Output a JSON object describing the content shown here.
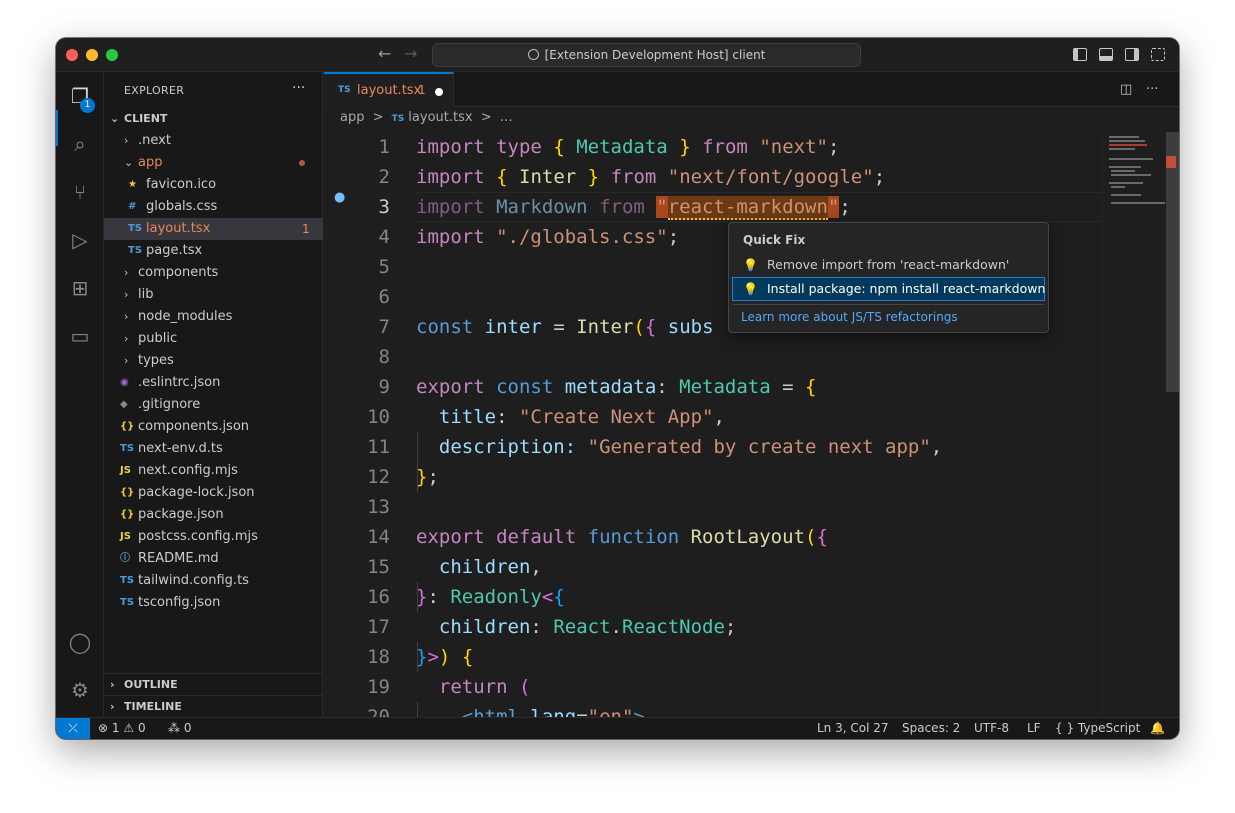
{
  "window": {
    "title": "[Extension Development Host] client"
  },
  "explorer": {
    "title": "EXPLORER",
    "badge": "1",
    "root": "CLIENT",
    "items": [
      {
        "label": ".next",
        "chev": "›",
        "icon": "",
        "color": "#cccccc"
      },
      {
        "label": "app",
        "chev": "⌄",
        "icon": "",
        "color": "#e7895d"
      },
      {
        "label": "favicon.ico",
        "chev": "",
        "icon": "★",
        "color": "#cccccc"
      },
      {
        "label": "globals.css",
        "chev": "",
        "icon": "#",
        "color": "#cccccc"
      },
      {
        "label": "layout.tsx",
        "chev": "",
        "icon": "TS",
        "color": "#e7895d",
        "count": "1"
      },
      {
        "label": "page.tsx",
        "chev": "",
        "icon": "TS",
        "color": "#cccccc"
      },
      {
        "label": "components",
        "chev": "›",
        "icon": "",
        "color": "#cccccc"
      },
      {
        "label": "lib",
        "chev": "›",
        "icon": "",
        "color": "#cccccc"
      },
      {
        "label": "node_modules",
        "chev": "›",
        "icon": "",
        "color": "#cccccc"
      },
      {
        "label": "public",
        "chev": "›",
        "icon": "",
        "color": "#cccccc"
      },
      {
        "label": "types",
        "chev": "›",
        "icon": "",
        "color": "#cccccc"
      },
      {
        "label": ".eslintrc.json",
        "chev": "",
        "icon": "◉",
        "color": "#cccccc"
      },
      {
        "label": ".gitignore",
        "chev": "",
        "icon": "◆",
        "color": "#cccccc"
      },
      {
        "label": "components.json",
        "chev": "",
        "icon": "{}",
        "color": "#cccccc"
      },
      {
        "label": "next-env.d.ts",
        "chev": "",
        "icon": "TS",
        "color": "#cccccc"
      },
      {
        "label": "next.config.mjs",
        "chev": "",
        "icon": "JS",
        "color": "#cccccc"
      },
      {
        "label": "package-lock.json",
        "chev": "",
        "icon": "{}",
        "color": "#cccccc"
      },
      {
        "label": "package.json",
        "chev": "",
        "icon": "{}",
        "color": "#cccccc"
      },
      {
        "label": "postcss.config.mjs",
        "chev": "",
        "icon": "JS",
        "color": "#cccccc"
      },
      {
        "label": "README.md",
        "chev": "",
        "icon": "ⓘ",
        "color": "#cccccc"
      },
      {
        "label": "tailwind.config.ts",
        "chev": "",
        "icon": "TS",
        "color": "#cccccc"
      },
      {
        "label": "tsconfig.json",
        "chev": "",
        "icon": "TS",
        "color": "#cccccc"
      }
    ],
    "outline": "OUTLINE",
    "timeline": "TIMELINE"
  },
  "tab": {
    "icon": "TS",
    "name": "layout.tsx",
    "count": "1"
  },
  "breadcrumb": {
    "folder": "app",
    "sep": ">",
    "file_icon": "TS",
    "file": "layout.tsx",
    "more": "…"
  },
  "code": {
    "line_numbers": [
      "1",
      "2",
      "3",
      "4",
      "5",
      "6",
      "7",
      "8",
      "9",
      "10",
      "11",
      "12",
      "13",
      "14",
      "15",
      "16",
      "17",
      "18",
      "19",
      "20"
    ],
    "l1": {
      "a": "import",
      "b": "type",
      "c": "{",
      "d": "Metadata",
      "e": "}",
      "f": "from",
      "g": "\"next\"",
      "h": ";"
    },
    "l2": {
      "a": "import",
      "c": "{",
      "d": "Inter",
      "e": "}",
      "f": "from",
      "g": "\"next/font/google\"",
      "h": ";"
    },
    "l3": {
      "a": "import",
      "d": "Markdown",
      "f": "from",
      "q1": "\"",
      "g": "react-markdown",
      "q2": "\"",
      "h": ";"
    },
    "l4": {
      "a": "import",
      "g": "\"./globals.css\"",
      "h": ";"
    },
    "l7": {
      "a": "const",
      "b": "inter",
      "c": "=",
      "d": "Inter",
      "e": "(",
      "f": "{",
      "g": "subs"
    },
    "l9": {
      "a": "export",
      "b": "const",
      "c": "metadata",
      "d": ":",
      "e": "Metadata",
      "f": "=",
      "g": "{"
    },
    "l10": {
      "a": "title:",
      "b": "\"Create Next App\"",
      "c": ","
    },
    "l11": {
      "a": "description:",
      "b": "\"Generated by create next app\"",
      "c": ","
    },
    "l12": {
      "a": "}",
      "b": ";"
    },
    "l14": {
      "a": "export",
      "b": "default",
      "c": "function",
      "d": "RootLayout",
      "e": "(",
      "f": "{"
    },
    "l15": {
      "a": "children",
      "b": ","
    },
    "l16": {
      "a": "}",
      "b": ":",
      "c": "Readonly",
      "d": "<",
      "e": "{"
    },
    "l17": {
      "a": "children",
      "b": ":",
      "c": "React",
      "d": ".",
      "e": "ReactNode",
      "f": ";"
    },
    "l18": {
      "a": "}",
      "b": ">",
      "c": ")",
      "d": "{"
    },
    "l19": {
      "a": "return",
      "b": "("
    },
    "l20": {
      "a": "<html",
      "b": "lang",
      "c": "=",
      "d": "\"en\"",
      "e": ">"
    }
  },
  "quickfix": {
    "title": "Quick Fix",
    "items": [
      "Remove import from 'react-markdown'",
      "Install package: npm install react-markdown"
    ],
    "link": "Learn more about JS/TS refactorings"
  },
  "status": {
    "errors": "1",
    "warnings": "0",
    "ports": "0",
    "position": "Ln 3, Col 27",
    "spaces": "Spaces: 2",
    "encoding": "UTF-8",
    "eol": "LF",
    "language": "TypeScript"
  },
  "colors": {
    "accent": "#0078d4",
    "modified": "#e7895d",
    "link": "#4daafc"
  }
}
